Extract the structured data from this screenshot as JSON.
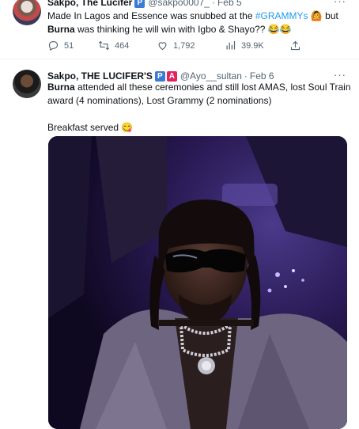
{
  "tweet1": {
    "name": "Sakpo, The Lucifer",
    "badge": "P",
    "handle": "@sakpo0007_",
    "sep": "·",
    "date": "Feb 5",
    "text_a": "Made In Lagos and Essence was snubbed at the ",
    "hashtag": "#GRAMMYs",
    "text_b": " 🙆 but",
    "bold": "Burna",
    "text_c": " was thinking he will win with Igbo & Shayo?? 😂😂",
    "actions": {
      "replies": "51",
      "retweets": "464",
      "views": "1,792",
      "likes": "39.9K"
    }
  },
  "tweet2": {
    "name": "Sakpo, THE LUCIFER'S",
    "badge1": "P",
    "badge2": "A",
    "handle": "@Ayo__sultan",
    "sep": "·",
    "date": "Feb 6",
    "bold": "Burna",
    "text_a": " attended all these ceremonies and still lost AMAS, lost Soul Train award (4 nominations), Lost Grammy (2 nominations)",
    "text_b": "Breakfast served 😋"
  },
  "more_label": "···",
  "icons": [
    "reply-icon",
    "retweet-icon",
    "like-icon",
    "views-icon",
    "share-icon",
    "more-icon"
  ],
  "colors": {
    "link": "#1d9bf0",
    "muted": "#536471",
    "text": "#0f1419"
  }
}
